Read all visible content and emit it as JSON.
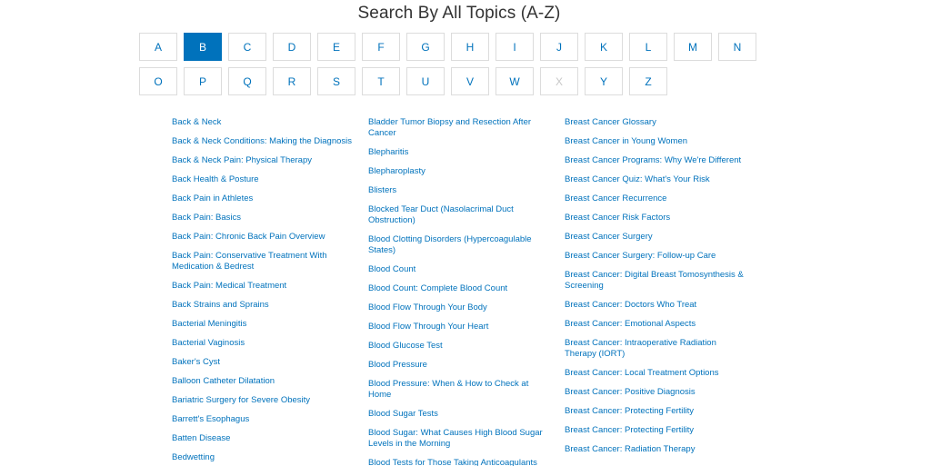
{
  "title": "Search By All Topics (A-Z)",
  "letters_row1": [
    {
      "label": "A",
      "state": "normal"
    },
    {
      "label": "B",
      "state": "active"
    },
    {
      "label": "C",
      "state": "normal"
    },
    {
      "label": "D",
      "state": "normal"
    },
    {
      "label": "E",
      "state": "normal"
    },
    {
      "label": "F",
      "state": "normal"
    },
    {
      "label": "G",
      "state": "normal"
    },
    {
      "label": "H",
      "state": "normal"
    },
    {
      "label": "I",
      "state": "normal"
    },
    {
      "label": "J",
      "state": "normal"
    },
    {
      "label": "K",
      "state": "normal"
    },
    {
      "label": "L",
      "state": "normal"
    },
    {
      "label": "M",
      "state": "normal"
    },
    {
      "label": "N",
      "state": "normal"
    }
  ],
  "letters_row2": [
    {
      "label": "O",
      "state": "normal"
    },
    {
      "label": "P",
      "state": "normal"
    },
    {
      "label": "Q",
      "state": "normal"
    },
    {
      "label": "R",
      "state": "normal"
    },
    {
      "label": "S",
      "state": "normal"
    },
    {
      "label": "T",
      "state": "normal"
    },
    {
      "label": "U",
      "state": "normal"
    },
    {
      "label": "V",
      "state": "normal"
    },
    {
      "label": "W",
      "state": "normal"
    },
    {
      "label": "X",
      "state": "disabled"
    },
    {
      "label": "Y",
      "state": "normal"
    },
    {
      "label": "Z",
      "state": "normal"
    }
  ],
  "colors": {
    "link": "#0072bc",
    "active_bg": "#0072bc",
    "disabled": "#c8c8c8",
    "border": "#dcdcdc"
  },
  "columns": [
    [
      "Back & Neck",
      "Back & Neck Conditions: Making the Diagnosis",
      "Back & Neck Pain: Physical Therapy",
      "Back Health & Posture",
      "Back Pain in Athletes",
      "Back Pain: Basics",
      "Back Pain: Chronic Back Pain Overview",
      "Back Pain: Conservative Treatment With Medication & Bedrest",
      "Back Pain: Medical Treatment",
      "Back Strains and Sprains",
      "Bacterial Meningitis",
      "Bacterial Vaginosis",
      "Baker's Cyst",
      "Balloon Catheter Dilatation",
      "Bariatric Surgery for Severe Obesity",
      "Barrett's Esophagus",
      "Batten Disease",
      "Bedwetting"
    ],
    [
      "Bladder Tumor Biopsy and Resection After Cancer",
      "Blepharitis",
      "Blepharoplasty",
      "Blisters",
      "Blocked Tear Duct (Nasolacrimal Duct Obstruction)",
      "Blood Clotting Disorders (Hypercoagulable States)",
      "Blood Count",
      "Blood Count: Complete Blood Count",
      "Blood Flow Through Your Body",
      "Blood Flow Through Your Heart",
      "Blood Glucose Test",
      "Blood Pressure",
      "Blood Pressure: When & How to Check at Home",
      "Blood Sugar Tests",
      "Blood Sugar: What Causes High Blood Sugar Levels in the Morning",
      "Blood Tests for Those Taking Anticoagulants (Blood Thinners)"
    ],
    [
      "Breast Cancer Glossary",
      "Breast Cancer in Young Women",
      "Breast Cancer Programs: Why We're Different",
      "Breast Cancer Quiz: What's Your Risk",
      "Breast Cancer Recurrence",
      "Breast Cancer Risk Factors",
      "Breast Cancer Surgery",
      "Breast Cancer Surgery: Follow-up Care",
      "Breast Cancer: Digital Breast Tomosynthesis & Screening",
      "Breast Cancer: Doctors Who Treat",
      "Breast Cancer: Emotional Aspects",
      "Breast Cancer: Intraoperative Radiation Therapy (IORT)",
      "Breast Cancer: Local Treatment Options",
      "Breast Cancer: Positive Diagnosis",
      "Breast Cancer: Protecting Fertility",
      "Breast Cancer: Protecting Fertility",
      "Breast Cancer: Radiation Therapy"
    ]
  ]
}
